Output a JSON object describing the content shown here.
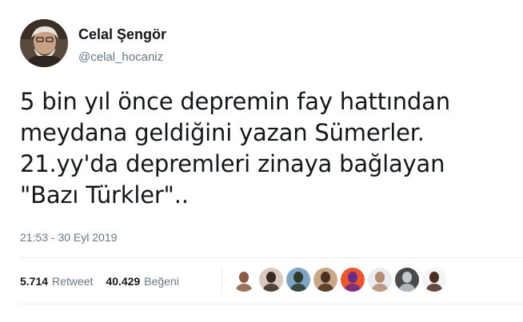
{
  "author": {
    "display_name": "Celal Şengör",
    "handle": "@celal_hocaniz"
  },
  "tweet": {
    "lines": [
      "5 bin yıl önce depremin fay hattından",
      "meydana geldiğini yazan Sümerler.",
      "21.yy'da depremleri zinaya bağlayan",
      "\"Bazı Türkler\".."
    ],
    "timestamp": "21:53 - 30 Eyl 2019"
  },
  "stats": {
    "retweet_count": "5.714",
    "retweet_label": "Retweet",
    "like_count": "40.429",
    "like_label": "Beğeni"
  },
  "likers": [
    {
      "name": "liker-avatar-1",
      "bg": "#ffffff",
      "fg": "#8a5a44"
    },
    {
      "name": "liker-avatar-2",
      "bg": "#d9c8bf",
      "fg": "#3b2a22"
    },
    {
      "name": "liker-avatar-3",
      "bg": "#7fa4c4",
      "fg": "#2d3b2a"
    },
    {
      "name": "liker-avatar-4",
      "bg": "#c9a889",
      "fg": "#4a3021"
    },
    {
      "name": "liker-avatar-5",
      "bg": "#e8552f",
      "fg": "#6a2a8a"
    },
    {
      "name": "liker-avatar-6",
      "bg": "#e9edf0",
      "fg": "#b48b74"
    },
    {
      "name": "liker-avatar-7",
      "bg": "#4a4a4a",
      "fg": "#c2c8cc"
    },
    {
      "name": "liker-avatar-8",
      "bg": "#f4f4f4",
      "fg": "#4a2c20"
    }
  ]
}
